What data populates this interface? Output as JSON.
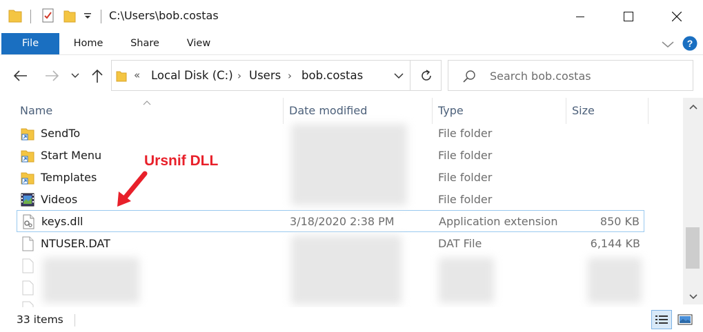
{
  "window": {
    "title": "C:\\Users\\bob.costas"
  },
  "ribbon": {
    "tabs": [
      "File",
      "Home",
      "Share",
      "View"
    ]
  },
  "address": {
    "overflow": "«",
    "segments": [
      "Local Disk (C:)",
      "Users",
      "bob.costas"
    ],
    "separator": "›"
  },
  "search": {
    "placeholder": "Search bob.costas"
  },
  "columns": {
    "name": "Name",
    "date": "Date modified",
    "type": "Type",
    "size": "Size"
  },
  "rows": [
    {
      "name": "SendTo",
      "date": "",
      "type": "File folder",
      "size": "",
      "icon": "folder-shortcut-icon"
    },
    {
      "name": "Start Menu",
      "date": "",
      "type": "File folder",
      "size": "",
      "icon": "folder-shortcut-icon"
    },
    {
      "name": "Templates",
      "date": "",
      "type": "File folder",
      "size": "",
      "icon": "folder-shortcut-icon"
    },
    {
      "name": "Videos",
      "date": "",
      "type": "File folder",
      "size": "",
      "icon": "videos-folder-icon"
    },
    {
      "name": "keys.dll",
      "date": "3/18/2020 2:38 PM",
      "type": "Application extension",
      "size": "850 KB",
      "icon": "dll-file-icon"
    },
    {
      "name": "NTUSER.DAT",
      "date": "",
      "type": "DAT File",
      "size": "6,144 KB",
      "icon": "file-icon"
    }
  ],
  "annotation": {
    "label": "Ursnif DLL",
    "color": "#e8202a"
  },
  "status": {
    "count": "33 items"
  },
  "colors": {
    "accent": "#1a6fc1",
    "selection_border": "#99c9ef",
    "help": "#1a6fc1"
  }
}
